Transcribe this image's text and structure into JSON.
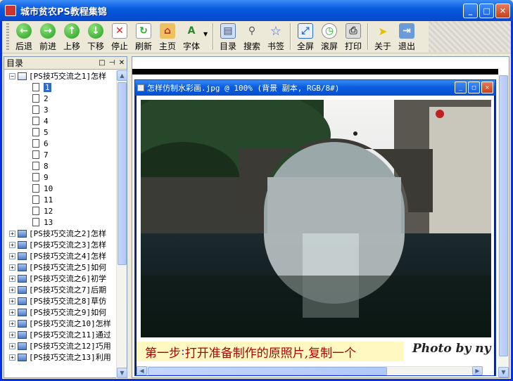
{
  "window": {
    "title": "城市贫农PS教程集锦"
  },
  "toolbar": {
    "items": [
      "后退",
      "前进",
      "上移",
      "下移",
      "停止",
      "刷新",
      "主页",
      "字体",
      "目录",
      "搜索",
      "书签",
      "全屏",
      "滚屏",
      "打印",
      "关于",
      "退出"
    ]
  },
  "left_pane": {
    "title": "目录",
    "root": {
      "label": "[PS技巧交流之1]怎样",
      "pages": [
        "1",
        "2",
        "3",
        "4",
        "5",
        "6",
        "7",
        "8",
        "9",
        "10",
        "11",
        "12",
        "13"
      ]
    },
    "books": [
      "[PS技巧交流之2]怎样",
      "[PS技巧交流之3]怎样",
      "[PS技巧交流之4]怎样",
      "[PS技巧交流之5]如何",
      "[PS技巧交流之6]初学",
      "[PS技巧交流之7]后期",
      "[PS技巧交流之8]草仿",
      "[PS技巧交流之9]如何",
      "[PS技巧交流之10]怎样",
      "[PS技巧交流之11]通过",
      "[PS技巧交流之12]巧用",
      "[PS技巧交流之13]利用"
    ]
  },
  "doc_window": {
    "title": "怎样仿制水彩画.jpg @ 100% (背景 副本, RGB/8#)",
    "caption_step": "第一步",
    "caption_colon": ":",
    "caption_text": "打开准备制作的原照片,复制一个",
    "signature": "Photo by ny"
  }
}
